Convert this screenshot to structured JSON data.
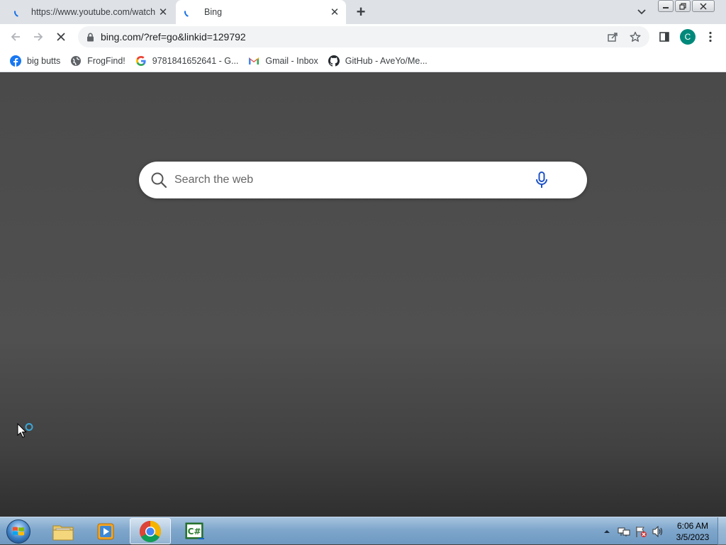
{
  "tabs": [
    {
      "title": "https://www.youtube.com/watch",
      "active": false
    },
    {
      "title": "Bing",
      "active": true
    }
  ],
  "toolbar": {
    "url": "bing.com/?ref=go&linkid=129792",
    "profile_initial": "C"
  },
  "bookmarks": [
    {
      "label": "big butts",
      "icon": "facebook-icon"
    },
    {
      "label": "FrogFind!",
      "icon": "globe-icon"
    },
    {
      "label": "9781841652641 - G...",
      "icon": "google-icon"
    },
    {
      "label": "Gmail - Inbox",
      "icon": "gmail-icon"
    },
    {
      "label": "GitHub - AveYo/Me...",
      "icon": "github-icon"
    }
  ],
  "page": {
    "search_placeholder": "Search the web"
  },
  "taskbar": {
    "apps": [
      "windows-explorer",
      "media-player",
      "chrome",
      "csharp-editor"
    ],
    "active_app": "chrome",
    "time": "6:06 AM",
    "date": "3/5/2023"
  },
  "colors": {
    "page_background": "#4a4a4a",
    "accent": "#1a73e8",
    "avatar": "#00897b"
  }
}
